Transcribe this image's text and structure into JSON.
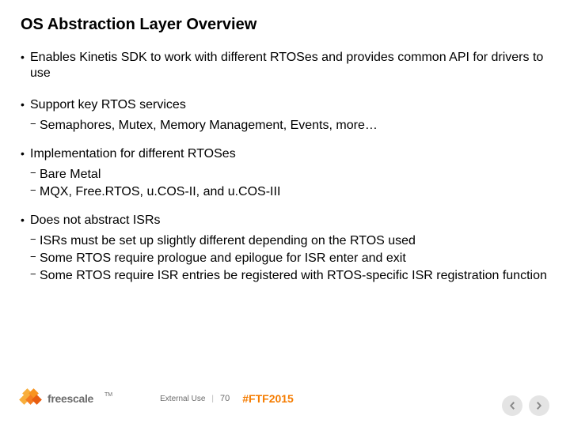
{
  "title": "OS Abstraction Layer Overview",
  "bullets": {
    "b1": "Enables Kinetis SDK to work with different RTOSes and provides common API for drivers to use",
    "b2": "Support key RTOS services",
    "b2s1": "Semaphores, Mutex, Memory Management, Events, more…",
    "b3": "Implementation for different RTOSes",
    "b3s1": "Bare Metal",
    "b3s2": "MQX, Free.RTOS, u.COS-II, and u.COS-III",
    "b4": "Does not abstract ISRs",
    "b4s1": "ISRs must be set up slightly different depending on the RTOS used",
    "b4s2": "Some RTOS require prologue and epilogue for ISR enter and exit",
    "b4s3": "Some RTOS require ISR entries be registered with RTOS-specific ISR registration function"
  },
  "footer": {
    "brand": "freescale",
    "tm": "TM",
    "usage": "External Use",
    "page": "70",
    "hashtag": "#FTF2015"
  }
}
